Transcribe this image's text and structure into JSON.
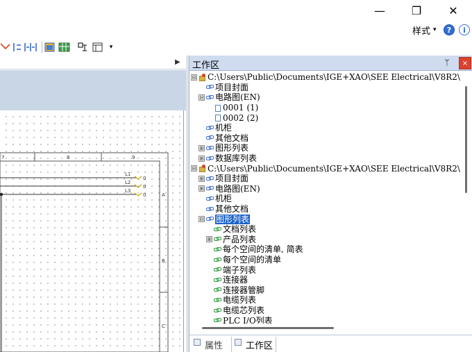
{
  "window": {
    "minimize_glyph": "—",
    "maximize_glyph": "❐",
    "close_glyph": "✕"
  },
  "ribbon": {
    "style_menu_label": "样式",
    "style_menu_caret": "▾",
    "help_icon": "help-icon",
    "help_glyph": "?",
    "info_icon": "info-icon",
    "info_glyph": "i"
  },
  "toolbar": {
    "dropdown_caret": "▾"
  },
  "left_pane": {
    "collapse_arrow": "▶"
  },
  "schematic": {
    "column_numbers": [
      "7",
      "8",
      "9"
    ],
    "row_letters": [
      "A",
      "B",
      "C"
    ],
    "line_labels": [
      "L1",
      "L2",
      "L3"
    ],
    "terminal_marks": [
      "0",
      "0",
      "0"
    ]
  },
  "panel": {
    "title": "工作区",
    "pin_glyph": "ᛘ",
    "close_glyph": "×",
    "tree": [
      {
        "level": 0,
        "expander": "⊟",
        "icon": "folder-icon",
        "label": "C:\\Users\\Public\\Documents\\IGE+XAO\\SEE Electrical\\V8R2\\"
      },
      {
        "level": 1,
        "expander": "",
        "icon": "chain-icon",
        "label": "项目封面"
      },
      {
        "level": 1,
        "expander": "⊟",
        "icon": "chain-icon",
        "label": "电路图(EN)"
      },
      {
        "level": 2,
        "expander": "",
        "icon": "page-icon",
        "label": "0001  (1)"
      },
      {
        "level": 2,
        "expander": "",
        "icon": "page-icon",
        "label": "0002  (2)"
      },
      {
        "level": 1,
        "expander": "",
        "icon": "chain-icon",
        "label": "机柜"
      },
      {
        "level": 1,
        "expander": "",
        "icon": "chain-icon",
        "label": "其他文档"
      },
      {
        "level": 1,
        "expander": "⊞",
        "icon": "chain-icon",
        "label": "图形列表"
      },
      {
        "level": 1,
        "expander": "⊞",
        "icon": "chain-icon",
        "label": "数据库列表"
      },
      {
        "level": 0,
        "expander": "⊟",
        "icon": "folder-icon",
        "label": "C:\\Users\\Public\\Documents\\IGE+XAO\\SEE Electrical\\V8R2\\"
      },
      {
        "level": 1,
        "expander": "⊞",
        "icon": "chain-icon",
        "label": "项目封面"
      },
      {
        "level": 1,
        "expander": "⊞",
        "icon": "chain-icon",
        "label": "电路图(EN)"
      },
      {
        "level": 1,
        "expander": "",
        "icon": "chain-icon",
        "label": "机柜"
      },
      {
        "level": 1,
        "expander": "",
        "icon": "chain-icon",
        "label": "其他文档"
      },
      {
        "level": 1,
        "expander": "⊟",
        "icon": "chain-icon",
        "label": "图形列表",
        "selected": true
      },
      {
        "level": 2,
        "expander": "",
        "icon": "green-chain-icon",
        "label": "文档列表"
      },
      {
        "level": 2,
        "expander": "⊞",
        "icon": "green-chain-icon",
        "label": "产品列表"
      },
      {
        "level": 2,
        "expander": "",
        "icon": "green-chain-icon",
        "label": "每个空间的清单, 简表"
      },
      {
        "level": 2,
        "expander": "",
        "icon": "green-chain-icon",
        "label": "每个空间的清单"
      },
      {
        "level": 2,
        "expander": "",
        "icon": "green-chain-icon",
        "label": "端子列表"
      },
      {
        "level": 2,
        "expander": "",
        "icon": "green-chain-icon",
        "label": "连接器"
      },
      {
        "level": 2,
        "expander": "",
        "icon": "green-chain-icon",
        "label": "连接器管脚"
      },
      {
        "level": 2,
        "expander": "",
        "icon": "green-chain-icon",
        "label": "电缆列表"
      },
      {
        "level": 2,
        "expander": "",
        "icon": "green-chain-icon",
        "label": "电缆芯列表"
      },
      {
        "level": 2,
        "expander": "",
        "icon": "green-chain-icon",
        "label": "PLC I/O列表"
      }
    ],
    "tabs": [
      {
        "label": "属性",
        "icon": "properties-icon"
      },
      {
        "label": "工作区",
        "icon": "workspace-icon",
        "active": true
      }
    ]
  }
}
